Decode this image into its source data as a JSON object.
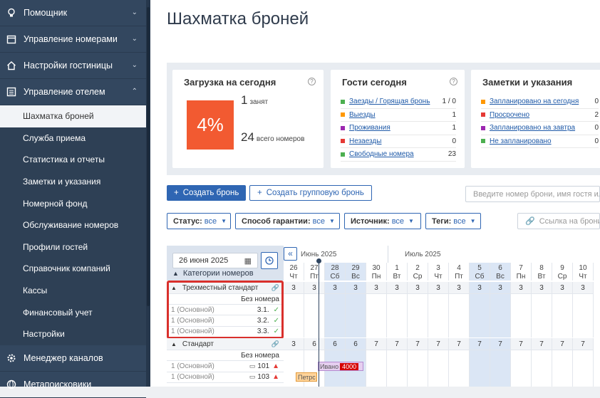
{
  "sidebar": {
    "sections": [
      {
        "label": "Помощник",
        "icon": "lightbulb-icon",
        "chev": "⌄"
      },
      {
        "label": "Управление номерами",
        "icon": "calendar-icon",
        "chev": "⌄"
      },
      {
        "label": "Настройки гостиницы",
        "icon": "house-icon",
        "chev": "⌄"
      },
      {
        "label": "Управление отелем",
        "icon": "list-icon",
        "chev": "⌃"
      }
    ],
    "sub_items": [
      "Шахматка броней",
      "Служба приема",
      "Статистика и отчеты",
      "Заметки и указания",
      "Номерной фонд",
      "Обслуживание номеров",
      "Профили гостей",
      "Справочник компаний",
      "Кассы",
      "Финансовый учет",
      "Настройки"
    ],
    "bottom_items": [
      {
        "label": "Менеджер каналов",
        "icon": "gear-icon"
      },
      {
        "label": "Метапоисковики",
        "icon": "globe-icon"
      }
    ]
  },
  "page": {
    "title": "Шахматка броней"
  },
  "cards": {
    "load": {
      "title": "Загрузка на сегодня",
      "percent": "4%",
      "occupied_num": "1",
      "occupied_label": "занят",
      "total_num": "24",
      "total_label": "всего номеров"
    },
    "guests": {
      "title": "Гости сегодня",
      "rows": [
        {
          "label": "Заезды / Горящая бронь",
          "value": "1 / 0",
          "color": "#4caf50"
        },
        {
          "label": "Выезды",
          "value": "1",
          "color": "#ff9800"
        },
        {
          "label": "Проживания",
          "value": "1",
          "color": "#9c27b0"
        },
        {
          "label": "Незаезды",
          "value": "0",
          "color": "#e53935"
        },
        {
          "label": "Свободные номера",
          "value": "23",
          "color": "#4caf50"
        }
      ]
    },
    "notes": {
      "title": "Заметки и указания",
      "rows": [
        {
          "label": "Запланировано на сегодня",
          "value": "0",
          "color": "#ff9800"
        },
        {
          "label": "Просрочено",
          "value": "2",
          "color": "#e53935"
        },
        {
          "label": "Запланировано на завтра",
          "value": "0",
          "color": "#9c27b0"
        },
        {
          "label": "Не запланировано",
          "value": "0",
          "color": "#4caf50"
        }
      ]
    }
  },
  "actions": {
    "create": "Создать бронь",
    "create_group": "Создать групповую бронь",
    "search_placeholder": "Введите номер брони, имя гостя или",
    "link_placeholder": "Ссылка на брони"
  },
  "filters": [
    {
      "label": "Статус:",
      "value": "все"
    },
    {
      "label": "Способ гарантии:",
      "value": "все"
    },
    {
      "label": "Источник:",
      "value": "все"
    },
    {
      "label": "Теги:",
      "value": "все"
    }
  ],
  "grid": {
    "date": "26 июня 2025",
    "collapse": "«",
    "categories_label": "Категории номеров",
    "month1": "Июнь 2025",
    "month2": "Июль 2025",
    "days": [
      {
        "d": "26",
        "w": "Чт"
      },
      {
        "d": "27",
        "w": "Пт"
      },
      {
        "d": "28",
        "w": "Сб"
      },
      {
        "d": "29",
        "w": "Вс"
      },
      {
        "d": "30",
        "w": "Пн"
      },
      {
        "d": "1",
        "w": "Вт"
      },
      {
        "d": "2",
        "w": "Ср"
      },
      {
        "d": "3",
        "w": "Чт"
      },
      {
        "d": "4",
        "w": "Пт"
      },
      {
        "d": "5",
        "w": "Сб"
      },
      {
        "d": "6",
        "w": "Вс"
      },
      {
        "d": "7",
        "w": "Пн"
      },
      {
        "d": "8",
        "w": "Вт"
      },
      {
        "d": "9",
        "w": "Ср"
      },
      {
        "d": "10",
        "w": "Чт"
      }
    ],
    "cat1": {
      "name": "Трехместный стандарт",
      "counts": [
        "3",
        "3",
        "3",
        "3",
        "3",
        "3",
        "3",
        "3",
        "3",
        "3",
        "3",
        "3",
        "3",
        "3",
        "3"
      ],
      "no_room": "Без номера",
      "rooms": [
        {
          "basis": "1 (Основной)",
          "num": "3.1."
        },
        {
          "basis": "1 (Основной)",
          "num": "3.2."
        },
        {
          "basis": "1 (Основной)",
          "num": "3.3."
        }
      ]
    },
    "cat2": {
      "name": "Стандарт",
      "counts": [
        "3",
        "6",
        "6",
        "6",
        "7",
        "7",
        "7",
        "7",
        "7",
        "7",
        "7",
        "7",
        "7",
        "7",
        "7"
      ],
      "no_room": "Без номера",
      "rooms": [
        {
          "basis": "1 (Основной)",
          "num": "101"
        },
        {
          "basis": "1 (Основной)",
          "num": "103"
        }
      ]
    },
    "bookings": [
      {
        "name": "Ивано",
        "price": "4000"
      },
      {
        "name": "Петрс"
      }
    ]
  }
}
